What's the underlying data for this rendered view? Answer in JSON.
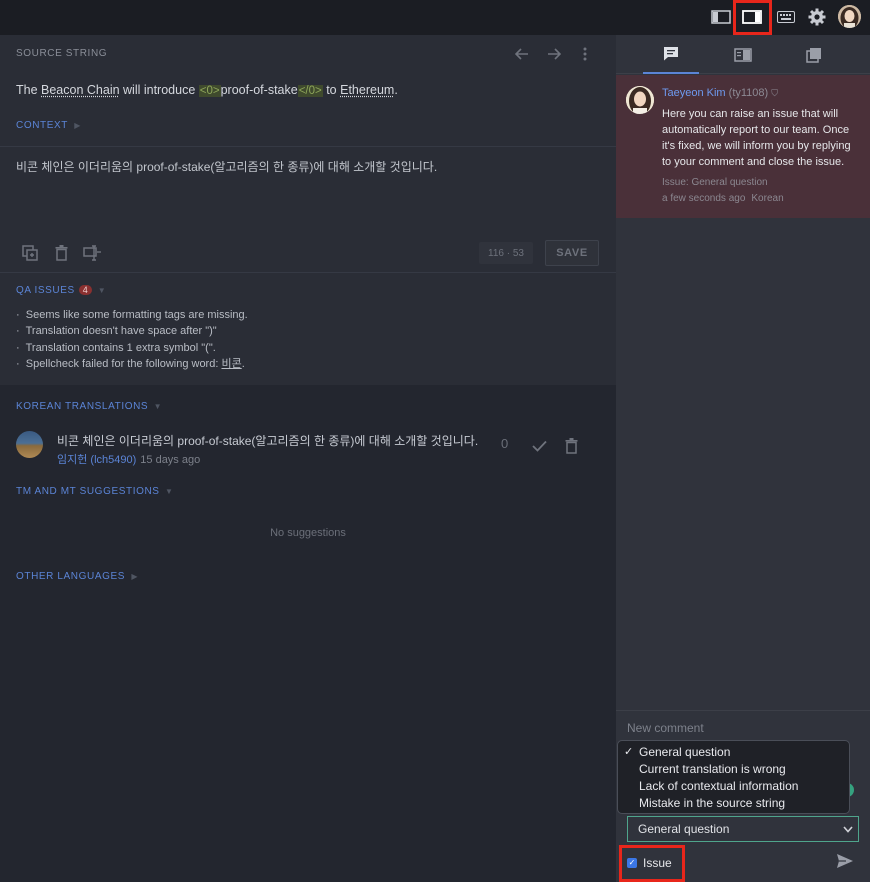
{
  "source": {
    "label": "SOURCE STRING",
    "parts": {
      "p1": "The ",
      "term1": "Beacon Chain",
      "p2": " will introduce ",
      "tag_open": "<0>",
      "term2": "proof-of-stake",
      "tag_close": "</0>",
      "p3": " to ",
      "term3": "Ethereum",
      "p4": "."
    },
    "context_label": "CONTEXT"
  },
  "editor": {
    "translation": "비콘 체인은 이더리움의 proof-of-stake(알고리즘의 한 종류)에 대해 소개할 것입니다.",
    "counter": "116 · 53",
    "save_label": "SAVE"
  },
  "qa": {
    "label": "QA ISSUES",
    "count": "4",
    "issue1": "Seems like some formatting tags are missing.",
    "issue2": "Translation doesn't have space after \")\"",
    "issue3": "Translation contains 1 extra symbol \"(\".",
    "issue4_prefix": "Spellcheck failed for the following word: ",
    "issue4_word": "비콘",
    "issue4_suffix": ".",
    "bullet": "·"
  },
  "translations": {
    "label": "KOREAN TRANSLATIONS",
    "item_text": "비콘 체인은 이더리움의 proof-of-stake(알고리즘의 한 종류)에 대해 소개할 것입니다.",
    "item_author": "임지헌 (lch5490)",
    "item_time": "15 days ago",
    "item_votes": "0"
  },
  "suggestions": {
    "label": "TM AND MT SUGGESTIONS",
    "empty": "No suggestions"
  },
  "other_languages": {
    "label": "OTHER LANGUAGES"
  },
  "comment": {
    "author": "Taeyeon Kim",
    "handle": "(ty1108)",
    "body": "Here you can raise an issue that will automatically report to our team. Once it's fixed, we will inform you by replying to your comment and close the issue.",
    "issue": "Issue: General question",
    "time": "a few seconds ago",
    "language": "Korean"
  },
  "compose": {
    "placeholder": "New comment",
    "options": [
      "General question",
      "Current translation is wrong",
      "Lack of contextual information",
      "Mistake in the source string"
    ],
    "selected": "General question",
    "issue_label": "Issue",
    "issue_checked": true
  },
  "colors": {
    "accent": "#5b84d6",
    "highlight": "#e8261b",
    "comment_bg": "#4a3039"
  }
}
